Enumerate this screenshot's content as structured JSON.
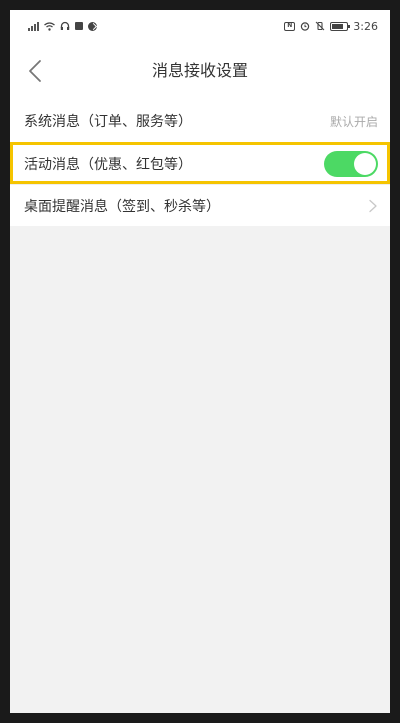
{
  "status_bar": {
    "time": "3:26",
    "wifi_icon": "wifi-icon",
    "battery_icon": "battery-icon"
  },
  "nav": {
    "title": "消息接收设置",
    "back_icon": "back-chevron-icon"
  },
  "settings": [
    {
      "label": "系统消息（订单、服务等）",
      "value": "默认开启"
    },
    {
      "label": "活动消息（优惠、红包等）",
      "toggle_on": true
    },
    {
      "label": "桌面提醒消息（签到、秒杀等）",
      "icon": "chevron-right-icon"
    }
  ],
  "colors": {
    "toggle_on": "#4cd964",
    "highlight": "#f5c400"
  }
}
